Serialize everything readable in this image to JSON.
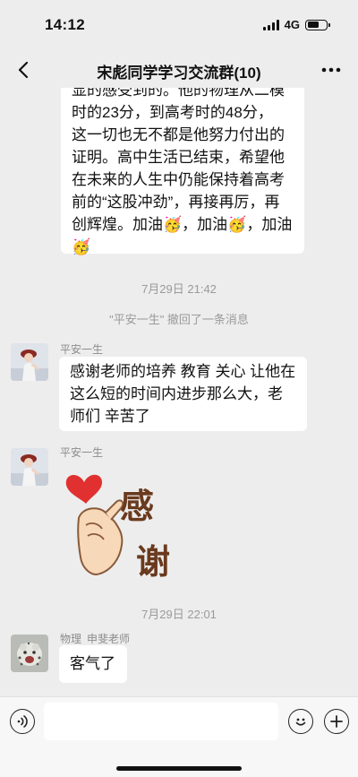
{
  "status": {
    "time": "14:12",
    "network": "4G",
    "battery_level": 0.6
  },
  "nav": {
    "title": "宋彪同学学习交流群(10)"
  },
  "messages": {
    "first_bubble_lines": [
      "显的感受到的。他的物理从二模",
      "时的23分，到高考时的48分，",
      "这一切也无不都是他努力付出的",
      "证明。高中生活已结束，希望他",
      "在未来的人生中仍能保持着高考",
      "前的“这股冲劲”，再接再厉，再",
      "创辉煌。加油🥳，加油🥳，加油",
      "🥳"
    ],
    "time1": "7月29日 21:42",
    "recall_notice": "\"平安一生\" 撤回了一条消息",
    "msg2": {
      "sender": "平安一生",
      "text_lines": [
        "感谢老师的培养 教育 关心 让他在",
        "这么短的时间内进步那么大，老",
        "师们 辛苦了"
      ]
    },
    "msg3": {
      "sender": "平安一生",
      "sticker_text": "感谢"
    },
    "time2": "7月29日 22:01",
    "msg4": {
      "sender_role": "物理",
      "sender_name": "申斐老师",
      "text": "客气了"
    }
  },
  "input": {
    "placeholder": ""
  }
}
